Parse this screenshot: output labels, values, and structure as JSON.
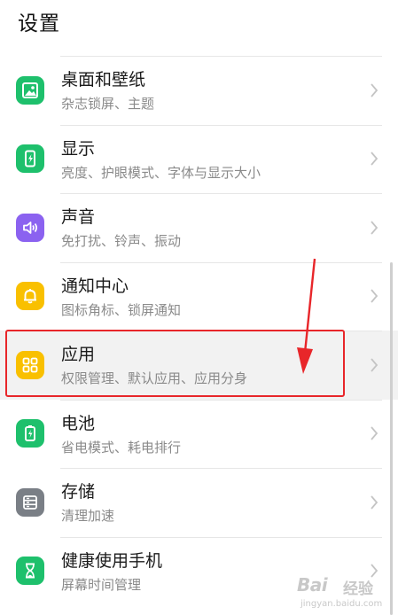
{
  "header": {
    "title": "设置"
  },
  "colors": {
    "icon_green": "#1ec06c",
    "icon_purple": "#8b62f0",
    "icon_yellow": "#f9c000",
    "icon_gray": "#7a7f86",
    "annotation_red": "#e8262a"
  },
  "items": [
    {
      "title": "桌面和壁纸",
      "subtitle": "杂志锁屏、主题",
      "icon": "wallpaper-icon",
      "color": "#1ec06c"
    },
    {
      "title": "显示",
      "subtitle": "亮度、护眼模式、字体与显示大小",
      "icon": "display-icon",
      "color": "#1ec06c"
    },
    {
      "title": "声音",
      "subtitle": "免打扰、铃声、振动",
      "icon": "sound-icon",
      "color": "#8b62f0"
    },
    {
      "title": "通知中心",
      "subtitle": "图标角标、锁屏通知",
      "icon": "bell-icon",
      "color": "#f9c000"
    },
    {
      "title": "应用",
      "subtitle": "权限管理、默认应用、应用分身",
      "icon": "apps-grid-icon",
      "color": "#f9c000"
    },
    {
      "title": "电池",
      "subtitle": "省电模式、耗电排行",
      "icon": "battery-icon",
      "color": "#1ec06c"
    },
    {
      "title": "存储",
      "subtitle": "清理加速",
      "icon": "storage-icon",
      "color": "#7a7f86"
    },
    {
      "title": "健康使用手机",
      "subtitle": "屏幕时间管理",
      "icon": "hourglass-icon",
      "color": "#1ec06c"
    }
  ],
  "watermark": {
    "brand": "Bai",
    "name": "经验",
    "url": "jingyan.baidu.com"
  }
}
